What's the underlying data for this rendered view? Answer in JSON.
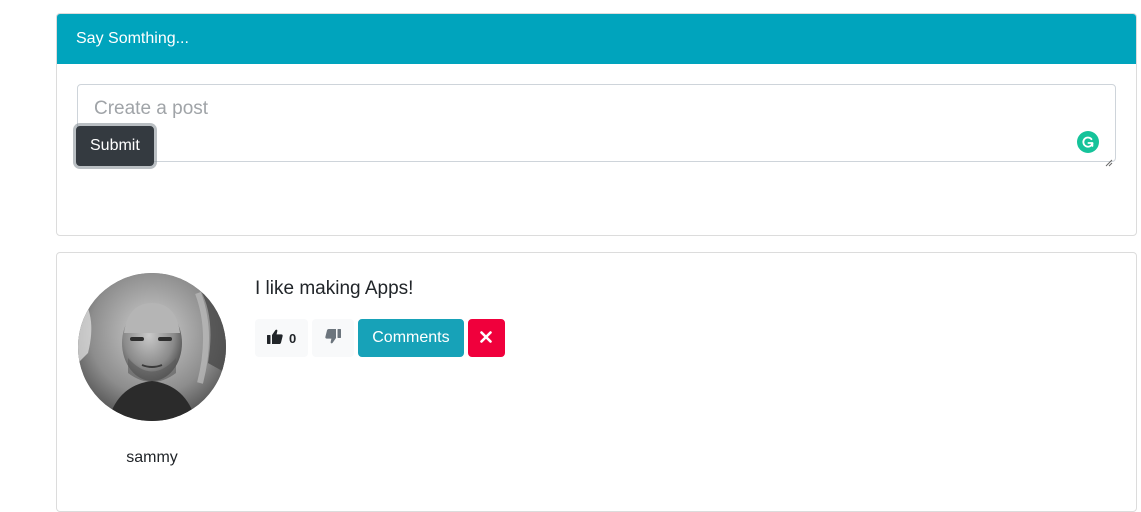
{
  "post_form": {
    "header_title": "Say Somthing...",
    "textarea_value": "",
    "textarea_placeholder": "Create a post",
    "submit_label": "Submit",
    "icons": {
      "grammarly": "grammarly-icon",
      "resize": "resize-handle-icon"
    }
  },
  "posts": [
    {
      "username": "sammy",
      "text": "I like making Apps!",
      "like_count": "0",
      "comments_label": "Comments",
      "icons": {
        "like": "thumbs-up-icon",
        "dislike": "thumbs-down-icon",
        "delete": "close-icon"
      }
    }
  ],
  "colors": {
    "header_bg": "#00a4bd",
    "submit_bg": "#343a40",
    "comments_bg": "#17a2b8",
    "delete_bg": "#f0003c",
    "grammarly": "#15c39a"
  }
}
